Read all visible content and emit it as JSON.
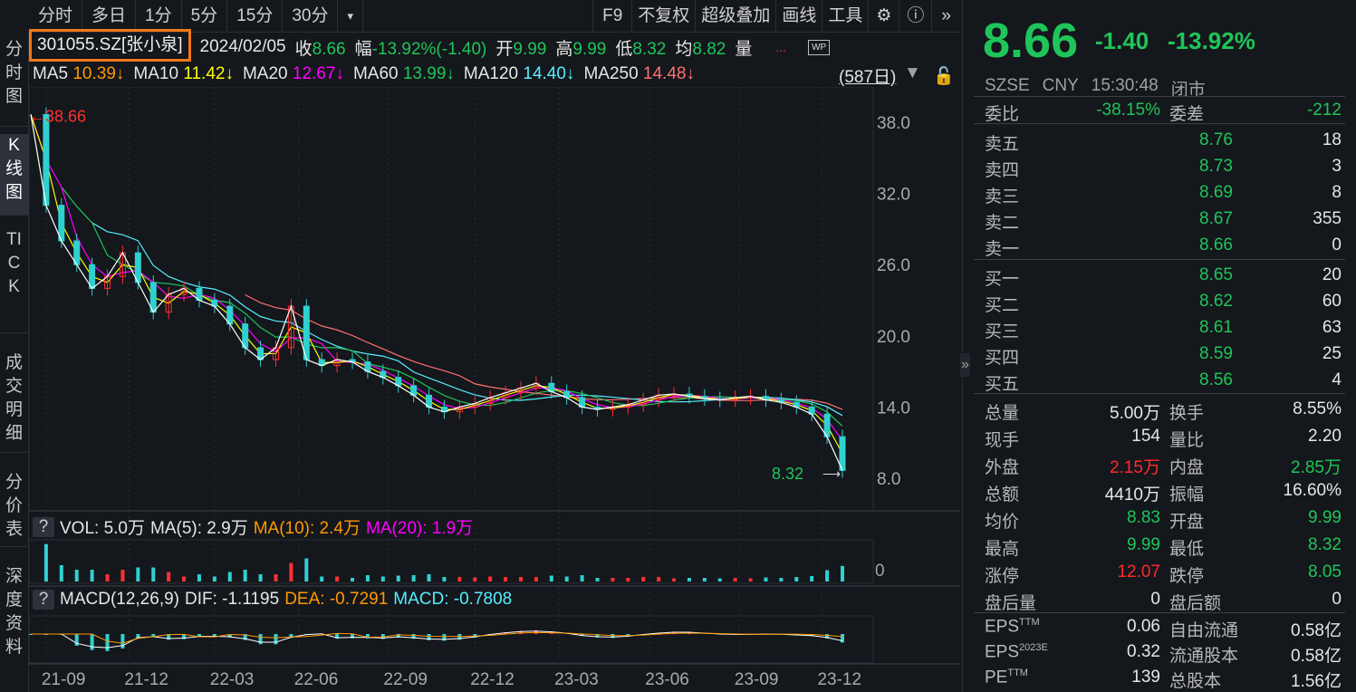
{
  "toolbar": {
    "periods": [
      "分时",
      "多日",
      "1分",
      "5分",
      "15分",
      "30分"
    ],
    "more": "▾",
    "right": [
      "F9",
      "不复权",
      "超级叠加",
      "画线",
      "工具"
    ]
  },
  "left_tabs": [
    "分时图",
    "K线图",
    "TICK",
    "成交明细",
    "分价表",
    "深度资料"
  ],
  "info": {
    "code": "301055.SZ[张小泉]",
    "date": "2024/02/05",
    "close_label": "收",
    "close": "8.66",
    "range_label": "幅",
    "range": "-13.92%(-1.40)",
    "open_label": "开",
    "open": "9.99",
    "high_label": "高",
    "high": "9.99",
    "low_label": "低",
    "low": "8.32",
    "avg_label": "均",
    "avg": "8.82",
    "vol_label": "量",
    "more": "...",
    "wp": "WP"
  },
  "ma": [
    {
      "name": "MA5",
      "value": "10.39↓",
      "color": "#ff9900"
    },
    {
      "name": "MA10",
      "value": "11.42↓",
      "color": "#ffff00"
    },
    {
      "name": "MA20",
      "value": "12.67↓",
      "color": "#ff00ff"
    },
    {
      "name": "MA60",
      "value": "13.99↓",
      "color": "#1fc55a"
    },
    {
      "name": "MA120",
      "value": "14.40↓",
      "color": "#55eeff"
    },
    {
      "name": "MA250",
      "value": "14.48↓",
      "color": "#ff7070"
    }
  ],
  "days": "(587日)",
  "price_axis": [
    "38.0",
    "32.0",
    "26.0",
    "20.0",
    "14.0",
    "8.0"
  ],
  "max_label": "←38.66",
  "min_label": "8.32",
  "time_axis": [
    "21-09",
    "21-12",
    "22-03",
    "22-06",
    "22-09",
    "22-12",
    "23-03",
    "23-06",
    "23-09",
    "23-12"
  ],
  "price_series": [
    38.66,
    31,
    28,
    26,
    24,
    25,
    27,
    24.5,
    22,
    23.5,
    24,
    23,
    22.5,
    21,
    19,
    18,
    19,
    22.5,
    18,
    17.5,
    18,
    17.8,
    17,
    16.5,
    15.8,
    15,
    14,
    13.6,
    14,
    14.3,
    14.8,
    15.2,
    15.6,
    16,
    15.3,
    14.8,
    14,
    13.8,
    14,
    14.2,
    14.6,
    15,
    15.1,
    14.9,
    14.7,
    14.6,
    14.8,
    14.9,
    14.6,
    14.4,
    14,
    13.4,
    11.5,
    8.66
  ],
  "volume": {
    "q": "?",
    "vol": "VOL: 5.0万",
    "ma5": "MA(5): 2.9万",
    "ma10": "MA(10): 2.4万",
    "ma20": "MA(20): 1.9万",
    "axis": "0"
  },
  "macd": {
    "q": "?",
    "name": "MACD(12,26,9)",
    "dif": "DIF: -1.1195",
    "dea": "DEA: -0.7291",
    "macd": "MACD: -0.7808"
  },
  "quote": {
    "price": "8.66",
    "change": "-1.40",
    "pct": "-13.92%",
    "exchange": "SZSE",
    "currency": "CNY",
    "time": "15:30:48",
    "status": "闭市"
  },
  "weibi": {
    "k1": "委比",
    "v1": "-38.15%",
    "k2": "委差",
    "v2": "-212"
  },
  "sell": [
    {
      "k": "卖五",
      "p": "8.76",
      "v": "18"
    },
    {
      "k": "卖四",
      "p": "8.73",
      "v": "3"
    },
    {
      "k": "卖三",
      "p": "8.69",
      "v": "8"
    },
    {
      "k": "卖二",
      "p": "8.67",
      "v": "355"
    },
    {
      "k": "卖一",
      "p": "8.66",
      "v": "0"
    }
  ],
  "buy": [
    {
      "k": "买一",
      "p": "8.65",
      "v": "20"
    },
    {
      "k": "买二",
      "p": "8.62",
      "v": "60"
    },
    {
      "k": "买三",
      "p": "8.61",
      "v": "63"
    },
    {
      "k": "买四",
      "p": "8.59",
      "v": "25"
    },
    {
      "k": "买五",
      "p": "8.56",
      "v": "4"
    }
  ],
  "stats": [
    {
      "k1": "总量",
      "v1": "5.00万",
      "c1": "w",
      "k2": "换手",
      "v2": "8.55%",
      "c2": "w"
    },
    {
      "k1": "现手",
      "v1": "154",
      "c1": "w",
      "k2": "量比",
      "v2": "2.20",
      "c2": "w"
    },
    {
      "k1": "外盘",
      "v1": "2.15万",
      "c1": "r",
      "k2": "内盘",
      "v2": "2.85万",
      "c2": "g"
    },
    {
      "k1": "总额",
      "v1": "4410万",
      "c1": "w",
      "k2": "振幅",
      "v2": "16.60%",
      "c2": "w"
    },
    {
      "k1": "均价",
      "v1": "8.83",
      "c1": "g",
      "k2": "开盘",
      "v2": "9.99",
      "c2": "g"
    },
    {
      "k1": "最高",
      "v1": "9.99",
      "c1": "g",
      "k2": "最低",
      "v2": "8.32",
      "c2": "g"
    },
    {
      "k1": "涨停",
      "v1": "12.07",
      "c1": "r",
      "k2": "跌停",
      "v2": "8.05",
      "c2": "g"
    },
    {
      "k1": "盘后量",
      "v1": "0",
      "c1": "w",
      "k2": "盘后额",
      "v2": "0",
      "c2": "w"
    }
  ],
  "fund": [
    {
      "k1": "EPS",
      "s1": "TTM",
      "v1": "0.06",
      "k2": "自由流通",
      "v2": "0.58亿"
    },
    {
      "k1": "EPS",
      "s1": "2023E",
      "v1": "0.32",
      "k2": "流通股本",
      "v2": "0.58亿"
    },
    {
      "k1": "PE",
      "s1": "TTM",
      "v1": "139",
      "k2": "总股本",
      "v2": "1.56亿"
    }
  ],
  "expand": "»"
}
